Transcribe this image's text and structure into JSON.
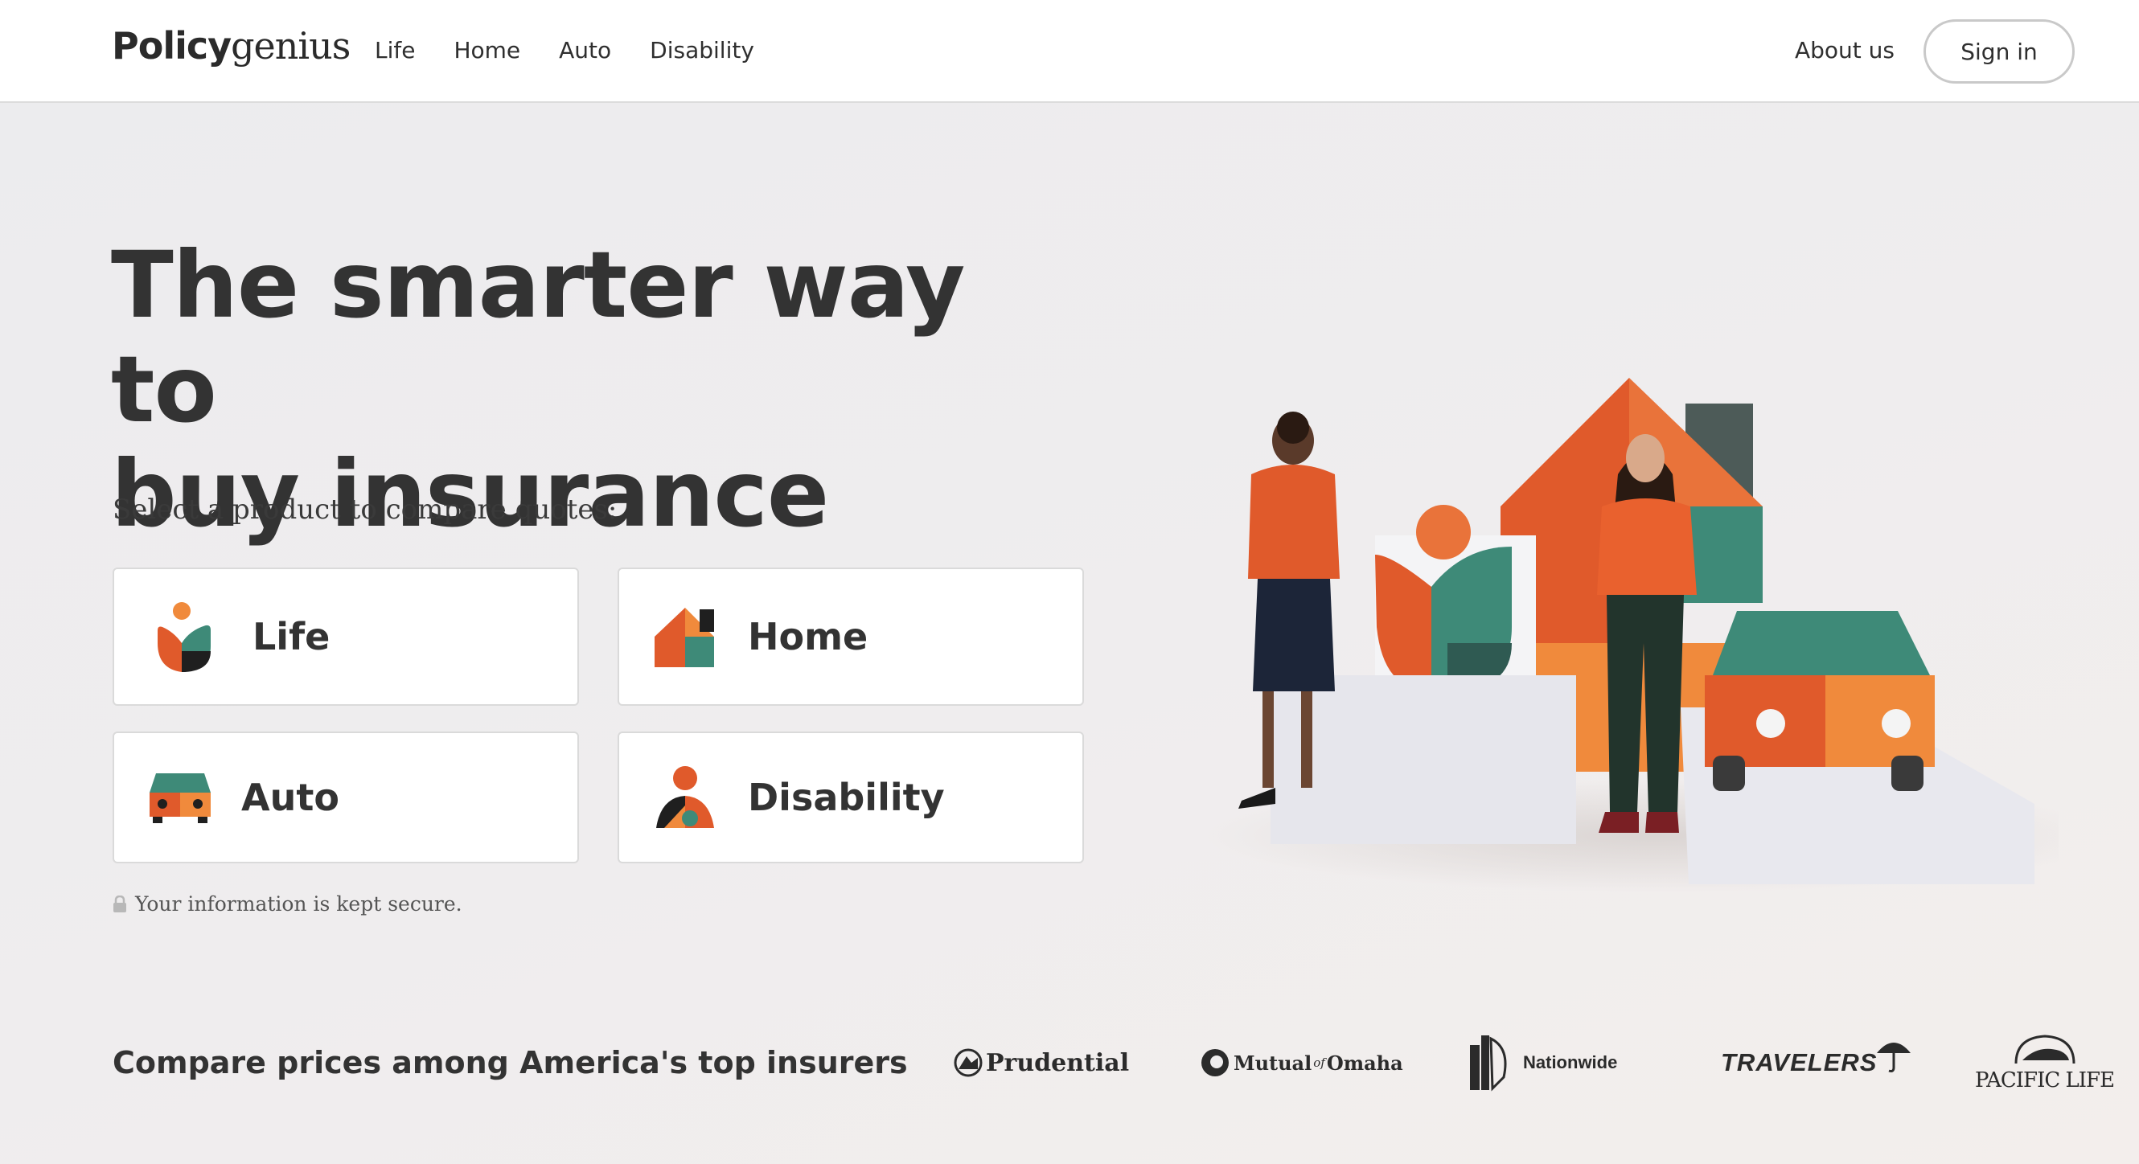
{
  "header": {
    "logo_bold": "Policy",
    "logo_light": "genius",
    "nav": [
      "Life",
      "Home",
      "Auto",
      "Disability"
    ],
    "about": "About us",
    "signin": "Sign in"
  },
  "hero": {
    "title_line1": "The smarter way to",
    "title_line2": "buy insurance",
    "prompt": "Select a product to compare quotes:",
    "products": [
      {
        "label": "Life",
        "icon": "life-tulip-icon"
      },
      {
        "label": "Home",
        "icon": "home-house-icon"
      },
      {
        "label": "Auto",
        "icon": "auto-car-icon"
      },
      {
        "label": "Disability",
        "icon": "disability-person-icon"
      }
    ],
    "secure_text": "Your information is kept secure."
  },
  "insurers": {
    "heading": "Compare prices among America's top insurers",
    "logos": [
      "Prudential",
      "Mutual of Omaha",
      "Nationwide",
      "TRAVELERS",
      "PACIFIC LIFE"
    ],
    "logo_texts": {
      "prudential": "Prudential",
      "mutual": "Mutual",
      "of": "of",
      "omaha": "Omaha",
      "nationwide": "Nationwide",
      "travelers": "TRAVELERS",
      "pacific": "PACIFIC LIFE"
    }
  },
  "colors": {
    "orange": "#e05a2b",
    "orange_light": "#f08a3c",
    "green": "#3e8a78",
    "dark": "#2b2b2b"
  }
}
